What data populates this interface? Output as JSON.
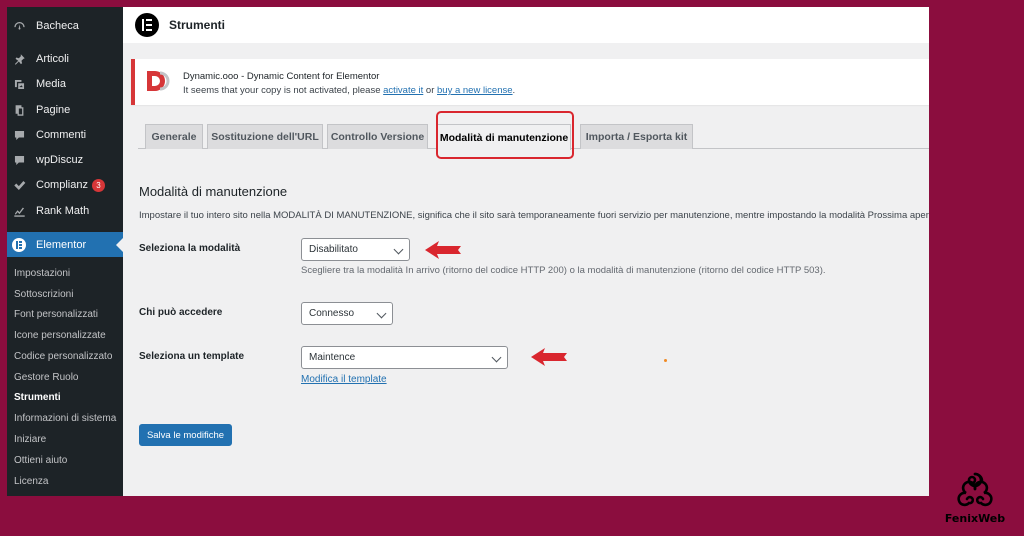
{
  "sidebar": {
    "menu": [
      {
        "label": "Bacheca",
        "icon": "dashboard-icon"
      },
      {
        "label": "Articoli",
        "icon": "pin-icon"
      },
      {
        "label": "Media",
        "icon": "media-icon"
      },
      {
        "label": "Pagine",
        "icon": "pages-icon"
      },
      {
        "label": "Commenti",
        "icon": "comments-icon"
      },
      {
        "label": "wpDiscuz",
        "icon": "comments-icon"
      },
      {
        "label": "Complianz",
        "icon": "check-icon",
        "badge": "3"
      },
      {
        "label": "Rank Math",
        "icon": "chart-icon"
      }
    ],
    "active": {
      "label": "Elementor",
      "icon": "elementor-icon"
    },
    "submenu": [
      "Impostazioni",
      "Sottoscrizioni",
      "Font personalizzati",
      "Icone personalizzate",
      "Codice personalizzato",
      "Gestore Ruolo",
      "Strumenti",
      "Informazioni di sistema",
      "Iniziare",
      "Ottieni aiuto",
      "Licenza"
    ],
    "submenu_current": "Strumenti"
  },
  "header": {
    "title": "Strumenti",
    "logo_icon": "elementor-logo-icon"
  },
  "notice": {
    "title": "Dynamic.ooo - Dynamic Content for Elementor",
    "text_before": "It seems that your copy is not activated, please ",
    "link1": "activate it",
    "text_middle": " or ",
    "link2": "buy a new license",
    "text_after": "."
  },
  "tabs": [
    {
      "label": "Generale",
      "active": false
    },
    {
      "label": "Sostituzione dell'URL",
      "active": false
    },
    {
      "label": "Controllo Versione",
      "active": false
    },
    {
      "label": "Modalità di manutenzione",
      "active": true
    },
    {
      "label": "Importa / Esporta kit",
      "active": false
    }
  ],
  "content": {
    "heading": "Modalità di manutenzione",
    "description": "Impostare il tuo intero sito nella MODALITÀ DI MANUTENZIONE, significa che il sito sarà temporaneamente fuori servizio per manutenzione, mentre impostando la modalità Prossima aper",
    "fields": {
      "mode": {
        "label": "Seleziona la modalità",
        "value": "Disabilitato",
        "hint": "Scegliere tra la modalità In arrivo (ritorno del codice HTTP 200) o la modalità di manutenzione (ritorno del codice HTTP 503)."
      },
      "access": {
        "label": "Chi può accedere",
        "value": "Connesso"
      },
      "template": {
        "label": "Seleziona un template",
        "value": "Maintence",
        "link": "Modifica il template"
      }
    },
    "save": "Salva le modifiche"
  },
  "brand": {
    "name": "FenixWeb"
  },
  "colors": {
    "background": "#8b0d3e",
    "sidebar": "#1d2327",
    "accent": "#2271b1",
    "annotation_red": "#d9262e"
  }
}
